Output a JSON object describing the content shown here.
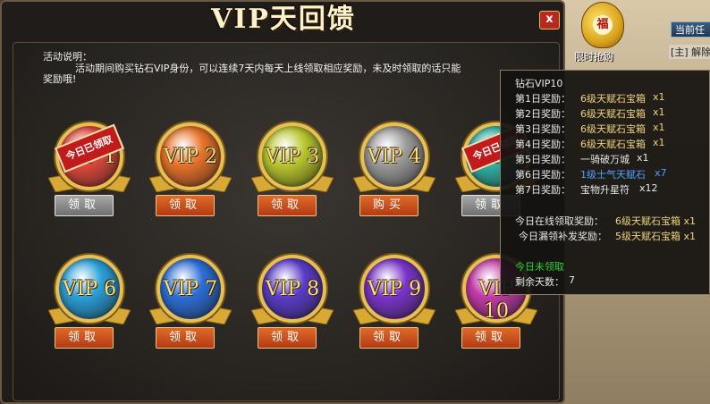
{
  "window": {
    "title": "VIP天回馈",
    "close_label": "x"
  },
  "description": {
    "label": "活动说明：",
    "text": "活动期间购买钻石VIP身份，可以连续7天内每天上线领取相应奖励，未及时领取的话只能",
    "text_tail": "奖励哦!"
  },
  "badges": [
    {
      "label": "VIP 1",
      "button": "领取",
      "claimed": true,
      "stamp": "今日已领取",
      "button_style": "grey",
      "color": "#e04a3c"
    },
    {
      "label": "VIP 2",
      "button": "领取",
      "claimed": false,
      "button_style": "orange",
      "color": "#e8732a"
    },
    {
      "label": "VIP 3",
      "button": "领取",
      "claimed": false,
      "button_style": "orange",
      "color": "#b9c72e"
    },
    {
      "label": "VIP 4",
      "button": "购买",
      "claimed": false,
      "button_style": "orange",
      "color": "#9a9a9a"
    },
    {
      "label": "VIP 5",
      "button": "领取",
      "claimed": true,
      "stamp": "今日已领取",
      "button_style": "grey",
      "color": "#2fb3a8"
    },
    {
      "label": "VIP 6",
      "button": "领取",
      "claimed": false,
      "button_style": "orange",
      "color": "#2a9fd9"
    },
    {
      "label": "VIP 7",
      "button": "领取",
      "claimed": false,
      "button_style": "orange",
      "color": "#2c6fd8"
    },
    {
      "label": "VIP 8",
      "button": "领取",
      "claimed": false,
      "button_style": "orange",
      "color": "#5a3cc8"
    },
    {
      "label": "VIP 9",
      "button": "领取",
      "claimed": false,
      "button_style": "orange",
      "color": "#7a34c9"
    },
    {
      "label": "VIP 10",
      "button": "领取",
      "claimed": false,
      "button_style": "orange",
      "color": "#c23aa8"
    }
  ],
  "tooltip": {
    "title": "钻石VIP10",
    "rewards": [
      {
        "day": "第1日奖励：",
        "item": "6级天赋石宝箱",
        "qty": "x1",
        "style": "gold"
      },
      {
        "day": "第2日奖励：",
        "item": "6级天赋石宝箱",
        "qty": "x1",
        "style": "gold"
      },
      {
        "day": "第3日奖励：",
        "item": "6级天赋石宝箱",
        "qty": "x1",
        "style": "gold"
      },
      {
        "day": "第4日奖励：",
        "item": "6级天赋石宝箱",
        "qty": "x1",
        "style": "gold"
      },
      {
        "day": "第5日奖励：",
        "item": "一骑破万城",
        "qty": "x1",
        "style": "plain"
      },
      {
        "day": "第6日奖励：",
        "item": "1级士气天赋石",
        "qty": "x7",
        "style": "blue"
      },
      {
        "day": "第7日奖励：",
        "item": "宝物升星符",
        "qty": "x12",
        "style": "plain"
      }
    ],
    "online_label": "今日在线领取奖励：",
    "online_value": "6级天赋石宝箱 x1",
    "makeup_label": "今日漏领补发奖励：",
    "makeup_value": "5级天赋石宝箱 x1",
    "status": "今日未领取",
    "remaining_label": "剩余天数：",
    "remaining_value": "7"
  },
  "side_ui": {
    "bag_char": "福",
    "limit_label": "限时抢购",
    "goto_label": "当前任",
    "main_link": "[主] 解除"
  },
  "colors": {
    "button_orange": "#c84a1a",
    "button_grey": "#8a8a8a",
    "stamp_red": "#c21b1b",
    "gold_text": "#f0d37c",
    "blue_text": "#4ca1ff",
    "green_text": "#2cd62c"
  }
}
